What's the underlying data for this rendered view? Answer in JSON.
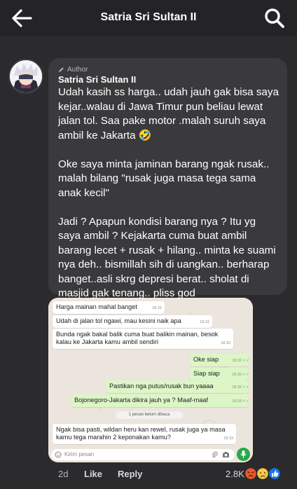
{
  "header": {
    "title": "Satria Sri Sultan II",
    "back_icon": "back-arrow-icon",
    "search_icon": "search-icon"
  },
  "comment": {
    "author_tag": "Author",
    "author_name": "Satria Sri Sultan II",
    "text": "Udah kasih ss harga.. udah jauh gak bisa saya kejar..walau di Jawa Timur pun beliau lewat jalan tol. Saa pake motor .malah suruh saya ambil ke Jakarta 🤣\n\nOke saya minta jaminan barang ngak rusak.. malah bilang \"rusak juga masa tega sama anak kecil\"\n\nJadi ? Apapun kondisi barang nya ? Itu yg saya ambil ? Kejakarta cuma buat ambil barang lecet + rusak + hilang.. minta ke suami nya deh.. bismillah sih di uangkan.. berharap banget..asli skrg depresi berat.. sholat di masjid gak tenang.. pliss god"
  },
  "screenshot": {
    "messages": [
      {
        "dir": "in",
        "text": "Harga mainan mahal banget",
        "time": "18.31"
      },
      {
        "dir": "in",
        "text": "Udah di jalan tol ngawi, mau kesini naik apa",
        "time": "18.31"
      },
      {
        "dir": "in",
        "text": "Bunda ngak bakal balik cuma buat balikin mainan, besok kalau ke Jakarta kamu ambil sendiri",
        "time": "18.32"
      },
      {
        "dir": "out",
        "text": "Oke siap",
        "time": "18.32"
      },
      {
        "dir": "out",
        "text": "Siap siap",
        "time": "18.32"
      },
      {
        "dir": "out",
        "text": "Pastikan nga putus/rusak bun yaaaa",
        "time": "18.32"
      },
      {
        "dir": "out",
        "text": "Bojonegoro-Jakarta dikira jauh ya ? Maaf-maaf",
        "time": "18.33"
      },
      {
        "dir": "in",
        "text": "Ngak bisa pasti, wildan heru kan rewel, rusak juga ya masa kamu tega marahin 2 keponakan kamu?",
        "time": "18.33"
      }
    ],
    "unread_label": "1 pesan belum dibaca",
    "compose_placeholder": "Kirim pesan"
  },
  "actions": {
    "time_ago": "2d",
    "like_label": "Like",
    "reply_label": "Reply",
    "reaction_count": "2.8K",
    "reaction_icons": [
      "angry-reaction-icon",
      "sad-reaction-icon",
      "like-reaction-icon"
    ]
  },
  "colors": {
    "background": "#2b2b2d",
    "bubble": "#3a3a3d",
    "outgoing_msg": "#dcf6c5",
    "like_blue": "#1877f2"
  }
}
